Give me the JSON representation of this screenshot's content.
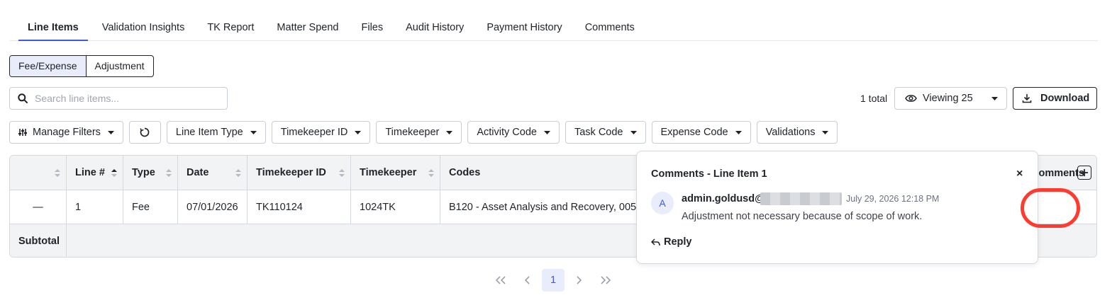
{
  "tabs": [
    {
      "label": "Line Items",
      "active": true
    },
    {
      "label": "Validation Insights"
    },
    {
      "label": "TK Report"
    },
    {
      "label": "Matter Spend"
    },
    {
      "label": "Files"
    },
    {
      "label": "Audit History"
    },
    {
      "label": "Payment History"
    },
    {
      "label": "Comments"
    }
  ],
  "segment": {
    "fee_expense": "Fee/Expense",
    "adjustment": "Adjustment",
    "selected": "Fee/Expense"
  },
  "search": {
    "placeholder": "Search line items...",
    "value": ""
  },
  "total_text": "1 total",
  "viewing": {
    "label": "Viewing 25"
  },
  "download": {
    "label": "Download"
  },
  "filters": {
    "manage": "Manage Filters",
    "line_item_type": "Line Item Type",
    "timekeeper_id": "Timekeeper ID",
    "timekeeper": "Timekeeper",
    "activity_code": "Activity Code",
    "task_code": "Task Code",
    "expense_code": "Expense Code",
    "validations": "Validations"
  },
  "table": {
    "headers": {
      "line": "Line #",
      "type": "Type",
      "date": "Date",
      "timekeeper_id": "Timekeeper ID",
      "timekeeper": "Timekeeper",
      "codes": "Codes",
      "comments": "Comments"
    },
    "row": {
      "select": "—",
      "line": "1",
      "type": "Fee",
      "date": "07/01/2026",
      "timekeeper_id": "TK110124",
      "timekeeper": "1024TK",
      "codes": "B120 - Asset Analysis and Recovery, 005"
    },
    "subtotal_label": "Subtotal"
  },
  "popover": {
    "title": "Comments - Line Item 1",
    "close": "×",
    "avatar_letter": "A",
    "author": "admin.goldusd@",
    "timestamp": "July 29, 2026 12:18 PM",
    "text": "Adjustment not necessary because of scope of work.",
    "reply": "Reply"
  },
  "pagination": {
    "first": "«",
    "prev": "‹",
    "current": "1",
    "next": "›",
    "last": "»"
  },
  "colors": {
    "accent": "#3b5bdb",
    "highlight": "#ff3b30"
  },
  "icons": [
    "search-icon",
    "eye-icon",
    "caret-down-icon",
    "download-icon",
    "sliders-icon",
    "refresh-icon",
    "sort-icon",
    "add-icon",
    "comment-icon",
    "close-icon",
    "reply-icon"
  ]
}
